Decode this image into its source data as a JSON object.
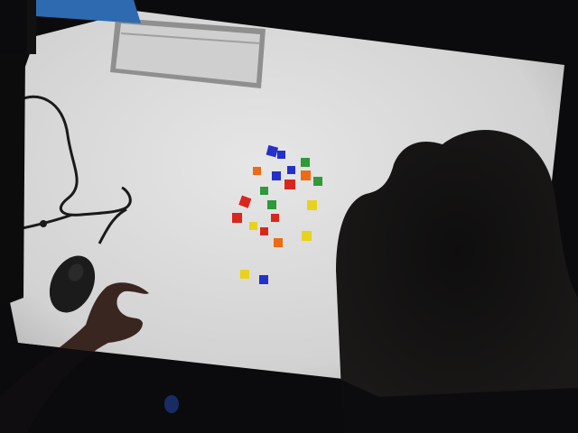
{
  "scene": {
    "colors": {
      "floor": "#0b0b0d",
      "table": "#dcdcdc",
      "table_shade": "#b9b9b9",
      "vent": "#c9c9c9",
      "vent_frame": "#9a9a9a",
      "monitor": "#2d6ab0",
      "cable": "#1a1a1a",
      "mouse": "#1b1b1b",
      "hand": "#3a2620",
      "shadow": "#0d0c0c",
      "block_red": "#d8271c",
      "block_blue": "#2430c8",
      "block_green": "#2f9a3a",
      "block_yellow": "#e8d21e",
      "block_orange": "#ee6a14"
    },
    "objects": [
      "table",
      "ceiling-vent",
      "monitor",
      "cable",
      "mouse",
      "hand",
      "colored-blocks",
      "arm-shadow"
    ]
  }
}
